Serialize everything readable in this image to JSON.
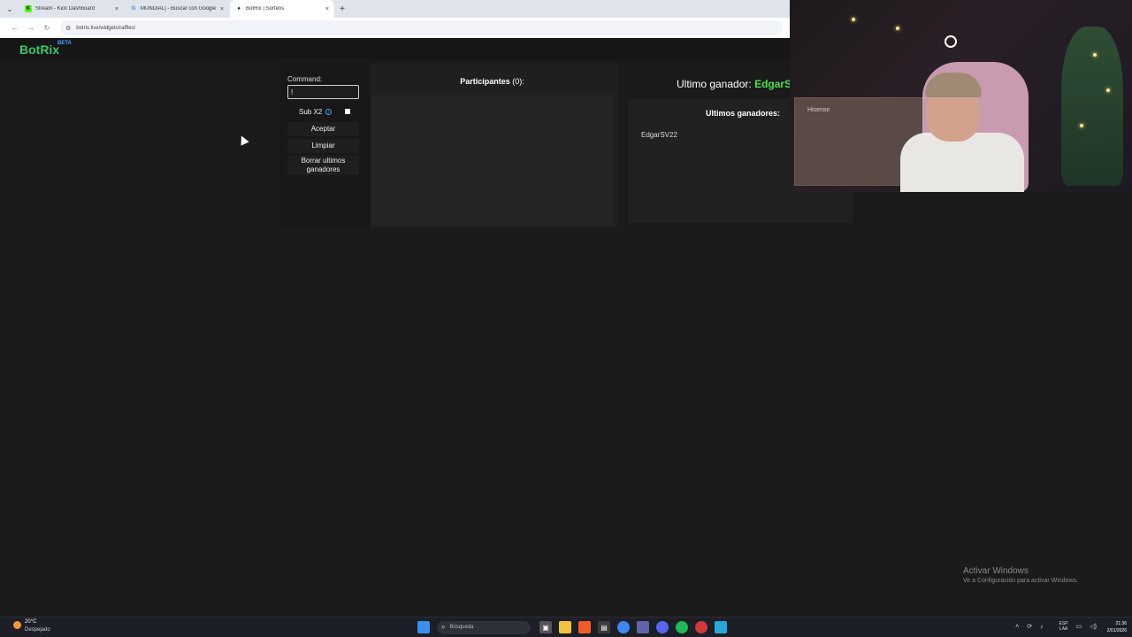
{
  "browser": {
    "tabs": [
      {
        "label": "Stream - Kick Dashboard",
        "close": "×",
        "favicon": "K",
        "favicon_color": "#53fc18"
      },
      {
        "label": "MUNDIAL] - Buscar con Google",
        "close": "×",
        "favicon": "G",
        "favicon_color": "#4285f4"
      },
      {
        "label": "BotRix | Sorteos",
        "close": "×",
        "favicon": "●",
        "favicon_color": "#222222"
      }
    ],
    "new_tab": "+",
    "url": "botrix.live/widgets/raffles/"
  },
  "app": {
    "logo": "BotRix",
    "logo_badge": "BETA",
    "controls": {
      "command_label": "Command:",
      "command_value": "!",
      "sub_label": "Sub X2",
      "accept_label": "Aceptar",
      "clear_label": "Limpiar",
      "delete_label_1": "Borrar ultimos",
      "delete_label_2": "ganadores"
    },
    "participants": {
      "title": "Participantes",
      "count": "(0):"
    },
    "winner": {
      "title": "Ultimo ganador:",
      "name": "EdgarSV",
      "last_title": "Ultimos ganadores:",
      "last_winners": [
        "EdgarSV22"
      ]
    }
  },
  "webcam": {
    "box_text": "Hisense"
  },
  "windows": {
    "activate_title": "Activar Windows",
    "activate_sub": "Ve a Configuración para activar Windows."
  },
  "taskbar": {
    "temp": "20°C",
    "weather": "Despejado",
    "search_placeholder": "Búsqueda",
    "lang_1": "ESP",
    "lang_2": "LAA",
    "time": "21:36",
    "date": "2/01/2026"
  }
}
